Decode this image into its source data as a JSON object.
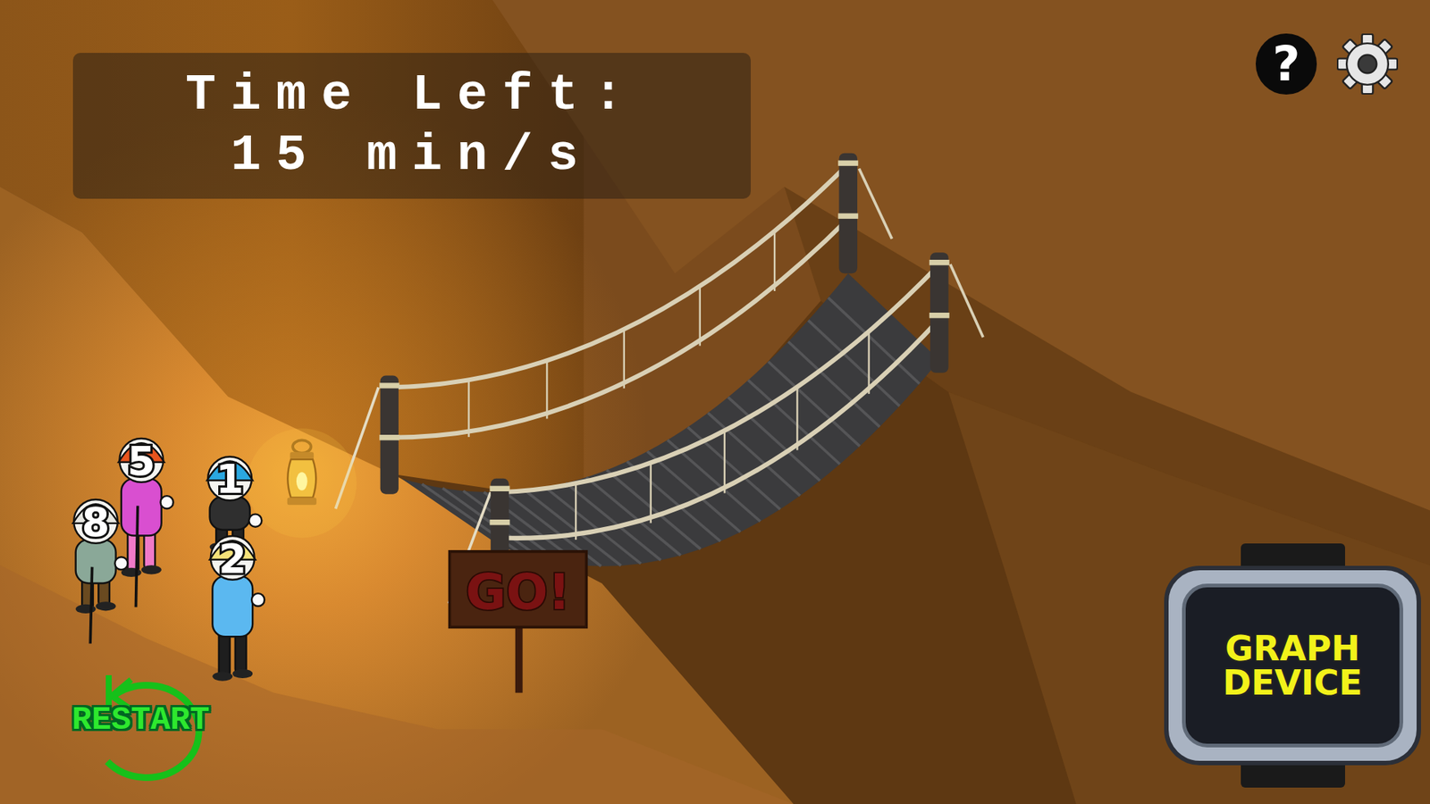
{
  "timer": {
    "label": "Time Left:",
    "value": "15 min/s"
  },
  "help": "?",
  "characters": [
    {
      "number": "5",
      "color": "#d94fd0"
    },
    {
      "number": "1",
      "color": "#2f2f2f"
    },
    {
      "number": "8",
      "color": "#8aa898"
    },
    {
      "number": "2",
      "color": "#5bb8f0"
    }
  ],
  "sign": "GO!",
  "restart": "RESTART",
  "graph_device": "GRAPH DEVICE"
}
